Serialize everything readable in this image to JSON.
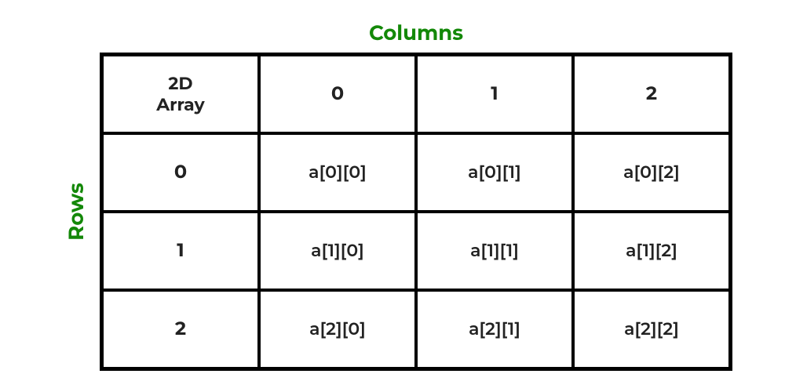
{
  "labels": {
    "columns": "Columns",
    "rows": "Rows",
    "corner": "2D\nArray"
  },
  "chart_data": {
    "type": "table",
    "columns": [
      "0",
      "1",
      "2"
    ],
    "rows": [
      "0",
      "1",
      "2"
    ],
    "cells": [
      [
        "a[0][0]",
        "a[0][1]",
        "a[0][2]"
      ],
      [
        "a[1][0]",
        "a[1][1]",
        "a[1][2]"
      ],
      [
        "a[2][0]",
        "a[2][1]",
        "a[2][2]"
      ]
    ]
  }
}
